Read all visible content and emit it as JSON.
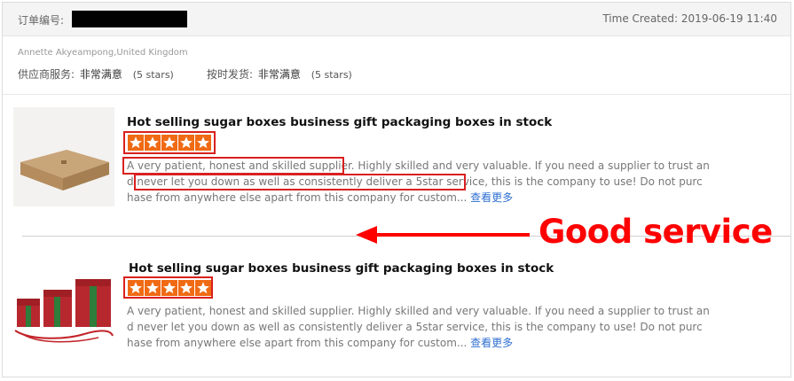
{
  "header": {
    "order_label": "订单编号:",
    "time_created": "Time Created: 2019-06-19 11:40"
  },
  "buyer": {
    "name_location": "Annette Akyeampong,United Kingdom",
    "supplier_service_label": "供应商服务:",
    "supplier_service_value": "非常满意",
    "supplier_service_stars": "(5 stars)",
    "on_time_label": "按时发货:",
    "on_time_value": "非常满意",
    "on_time_stars": "(5 stars)"
  },
  "reviews": [
    {
      "title": "Hot selling sugar boxes business gift packaging boxes in stock",
      "stars": 5,
      "lines": [
        "A very patient, honest and skilled supplier. Highly skilled and very valuable. If you need a supplier to trust an",
        "d never let you down as well as consistently deliver a 5star service, this is the company to use! Do not purc",
        "hase from anywhere else apart from this company for custom..."
      ],
      "more": "查看更多",
      "image_icon": "kraft-box-image"
    },
    {
      "title": "Hot selling sugar boxes business gift packaging boxes in stock",
      "stars": 5,
      "lines": [
        "A very patient, honest and skilled supplier. Highly skilled and very valuable. If you need a supplier to trust an",
        "d never let you down as well as consistently deliver a 5star service, this is the company to use! Do not purc",
        "hase from anywhere else apart from this company for custom..."
      ],
      "more": "查看更多",
      "image_icon": "gift-boxes-image"
    }
  ],
  "annotation": {
    "label": "Good service"
  },
  "colors": {
    "star": "#f06a14",
    "highlight": "#d9201f",
    "annotation": "#ff0000",
    "link": "#2f6fd1"
  }
}
